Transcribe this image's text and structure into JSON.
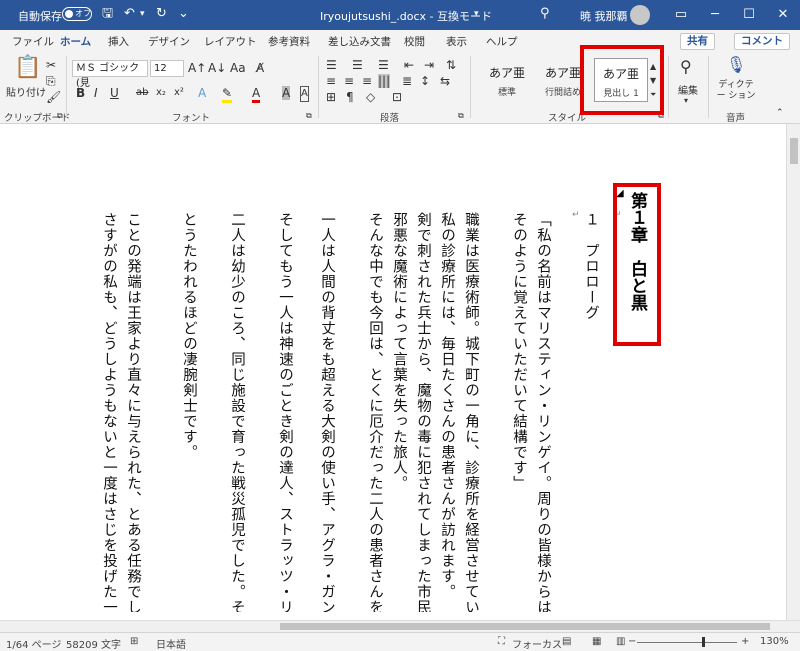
{
  "titlebar": {
    "autosave_label": "自動保存",
    "autosave_state": "オフ",
    "doc_title": "Iryoujutsushi_.docx - 互換モード",
    "user_name": "暁 我那覇",
    "accent_color": "#2b579a"
  },
  "tabs": [
    "ファイル",
    "ホーム",
    "挿入",
    "デザイン",
    "レイアウト",
    "参考資料",
    "差し込み文書",
    "校閲",
    "表示",
    "ヘルプ"
  ],
  "active_tab": "ホーム",
  "share_label": "共有",
  "comment_label": "コメント",
  "ribbon": {
    "paste_label": "貼り付け",
    "clipboard_group": "クリップボード",
    "font_name": "ＭＳ ゴシック (見",
    "font_size": "12",
    "font_group": "フォント",
    "paragraph_group": "段落",
    "styles": [
      {
        "preview": "あア亜",
        "name": "標準"
      },
      {
        "preview": "あア亜",
        "name": "行間詰め"
      },
      {
        "preview": "あア亜",
        "name": "見出し 1"
      }
    ],
    "style_group": "スタイル",
    "edit_label": "編集",
    "dictation_label": "ディクテー ション",
    "voice_group": "音声"
  },
  "document": {
    "heading": "第１章　白と黒",
    "columns": [
      "１　プロローグ",
      "「私の名前はマリスティン・リンゲイ。周りの皆様からはマリス",
      "そのように覚えていただいて結構です」",
      "職業は医療術師。城下町の一角に、診療所を経営させていただい",
      "私の診療所には、毎日たくさんの患者さんが訪れます。",
      "剣で刺された兵士から、魔物の毒に犯されてしまった市民。",
      "邪悪な魔術によって言葉を失った旅人。",
      "そんな中でも今回は、とくに厄介だった二人の患者さんをご紹介",
      "一人は人間の背丈をも超える大剣の使い手、アグラ・ガンマフェ",
      "そしてもう一人は神速のごとき剣の達人、ストラッツ・リアノス。",
      "二人は幼少のころ、同じ施設で育った戦災孤児でした。そんな彼",
      "とうたわれるほどの凄腕剣士です。",
      "ことの発端は王家より直々に与えられた、とある任務でした。",
      "さすがの私も、どうしようもないと一度はさじを投げた一例です"
    ]
  },
  "status": {
    "page": "1/64 ページ",
    "words": "58209 文字",
    "language": "日本語",
    "focus": "フォーカス",
    "zoom": "130%"
  }
}
